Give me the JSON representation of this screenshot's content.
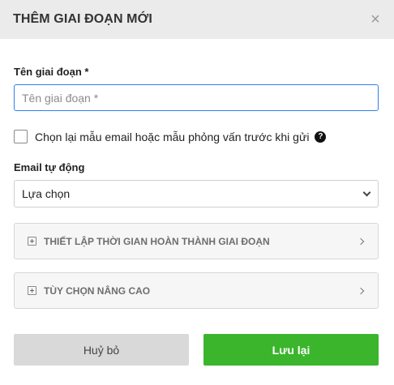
{
  "modal": {
    "title": "THÊM GIAI ĐOẠN MỚI",
    "close_icon": "×"
  },
  "form": {
    "stage_name": {
      "label": "Tên giai đoạn *",
      "value": "",
      "placeholder": "Tên giai đoạn *"
    },
    "reselect_templates": {
      "label": "Chọn lại mẫu email hoặc mẫu phỏng vấn trước khi gửi",
      "checked": false,
      "help_icon": "?"
    },
    "auto_email": {
      "label": "Email tự động",
      "selected": "Lựa chọn"
    }
  },
  "sections": [
    {
      "label": "THIẾT LẬP THỜI GIAN HOÀN THÀNH GIAI ĐOẠN",
      "icon": "plus-square-icon"
    },
    {
      "label": "TÙY CHỌN NÂNG CAO",
      "icon": "plus-square-icon"
    }
  ],
  "actions": {
    "cancel_label": "Huỷ bỏ",
    "save_label": "Lưu lại"
  },
  "colors": {
    "header_bg": "#ebebeb",
    "input_focus_border": "#2f80ed",
    "save_button": "#3ab52c",
    "cancel_button": "#d9d9d9"
  }
}
